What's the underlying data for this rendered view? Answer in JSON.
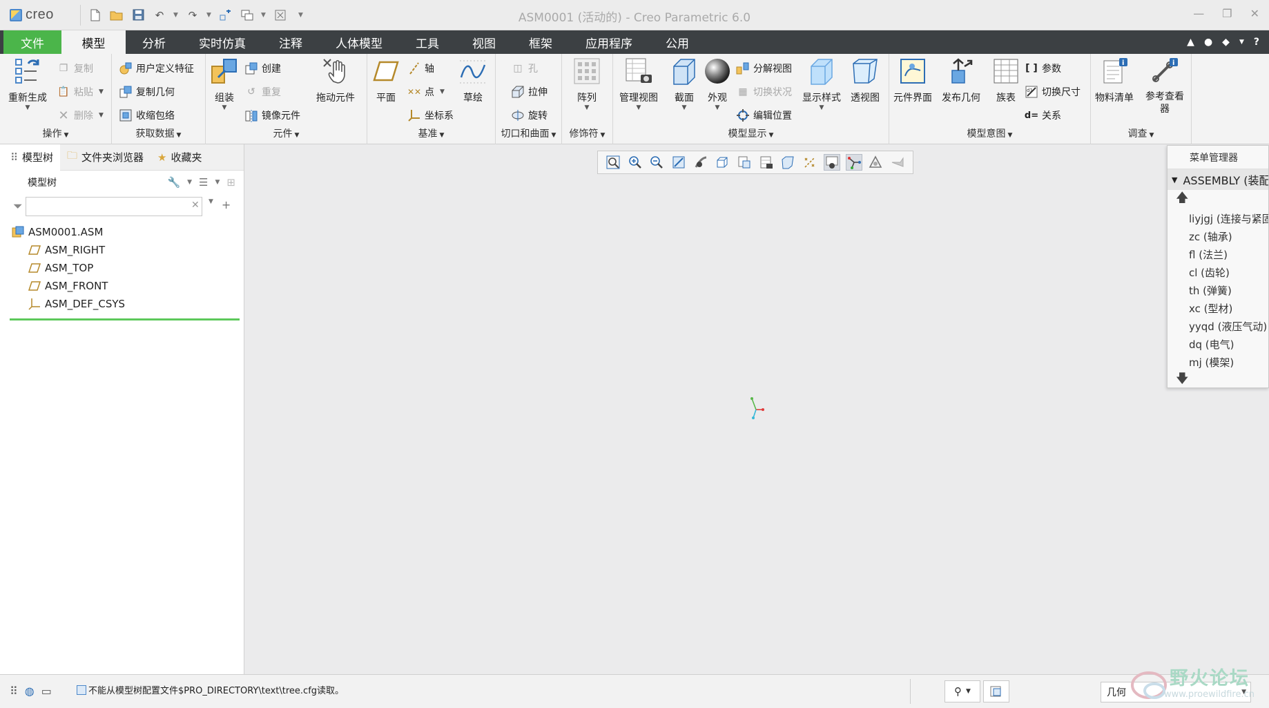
{
  "app": {
    "logo_text": "creo",
    "window_title": "ASM0001 (活动的) - Creo Parametric 6.0"
  },
  "menu": {
    "file": "文件",
    "tabs": [
      "模型",
      "分析",
      "实时仿真",
      "注释",
      "人体模型",
      "工具",
      "视图",
      "框架",
      "应用程序",
      "公用"
    ]
  },
  "ribbon": {
    "operations": {
      "label": "操作",
      "regenerate": "重新生成",
      "copy": "复制",
      "paste": "粘贴",
      "delete": "删除"
    },
    "get_data": {
      "label": "获取数据",
      "udf": "用户定义特征",
      "copy_geom": "复制几何",
      "shrinkwrap": "收缩包络"
    },
    "component": {
      "label": "元件",
      "assemble": "组装",
      "create": "创建",
      "repeat": "重复",
      "mirror": "镜像元件",
      "drag": "拖动元件"
    },
    "datum": {
      "label": "基准",
      "plane": "平面",
      "axis": "轴",
      "point": "点",
      "csys": "坐标系",
      "sketch": "草绘"
    },
    "cut_surface": {
      "label": "切口和曲面",
      "hole": "孔",
      "extrude": "拉伸",
      "revolve": "旋转"
    },
    "modifiers": {
      "label": "修饰符",
      "pattern": "阵列"
    },
    "model_display": {
      "label": "模型显示",
      "manage_views": "管理视图",
      "section": "截面",
      "appearance": "外观",
      "explode": "分解视图",
      "toggle_status": "切换状况",
      "edit_position": "编辑位置",
      "display_style": "显示样式",
      "perspective": "透视图"
    },
    "model_intent": {
      "label": "模型意图",
      "comp_interface": "元件界面",
      "publish_geom": "发布几何",
      "family_table": "族表",
      "parameters": "参数",
      "switch_dims": "切换尺寸",
      "relations": "关系"
    },
    "investigate": {
      "label": "调查",
      "bom": "物料清单",
      "ref_viewer": "参考查看器"
    }
  },
  "panel": {
    "tabs": [
      "模型树",
      "文件夹浏览器",
      "收藏夹"
    ],
    "tree_title": "模型树",
    "filter_placeholder": "",
    "nodes": [
      "ASM0001.ASM",
      "ASM_RIGHT",
      "ASM_TOP",
      "ASM_FRONT",
      "ASM_DEF_CSYS"
    ]
  },
  "menu_manager": {
    "title": "菜单管理器",
    "header": "ASSEMBLY (装配)",
    "items": [
      "liyjgj (连接与紧固)",
      "zc (轴承)",
      "fl (法兰)",
      "cl (齿轮)",
      "th (弹簧)",
      "xc (型材)",
      "yyqd (液压气动)",
      "dq (电气)",
      "mj (模架)"
    ]
  },
  "status": {
    "message": "不能从模型树配置文件$PRO_DIRECTORY\\text\\tree.cfg读取。",
    "filter_value": "几何"
  },
  "watermark": {
    "title": "野火论坛",
    "url": "www.proewildfire.cn"
  },
  "colors": {
    "file_tab": "#4bb54a",
    "menubar": "#3c4043",
    "viewport": "#ebebec",
    "tree_divider": "#5cc85a"
  }
}
